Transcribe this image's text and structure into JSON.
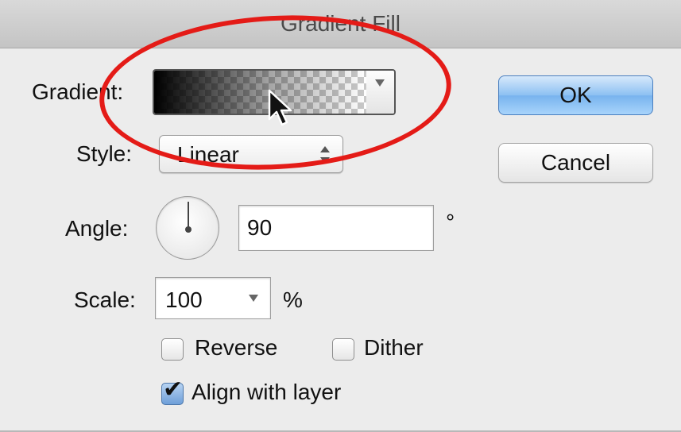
{
  "window": {
    "title": "Gradient Fill"
  },
  "gradient": {
    "label": "Gradient:"
  },
  "style": {
    "label": "Style:",
    "value": "Linear"
  },
  "angle": {
    "label": "Angle:",
    "value": "90",
    "unit": "°"
  },
  "scale": {
    "label": "Scale:",
    "value": "100",
    "unit": "%"
  },
  "options": {
    "reverse": {
      "label": "Reverse",
      "checked": false
    },
    "dither": {
      "label": "Dither",
      "checked": false
    },
    "align_with_layer": {
      "label": "Align with layer",
      "checked": true
    }
  },
  "buttons": {
    "ok": "OK",
    "cancel": "Cancel"
  },
  "icons": {
    "gradient_dropdown": "chevron-down-icon",
    "style_stepper": "updown-arrows-icon",
    "scale_dropdown": "chevron-down-icon",
    "checkmark": "checkmark-icon",
    "cursor": "mouse-pointer-icon"
  },
  "colors": {
    "annotation": "#e41b17",
    "default_button": "#8cc0f2",
    "checked_box": "#6e9fd9"
  }
}
